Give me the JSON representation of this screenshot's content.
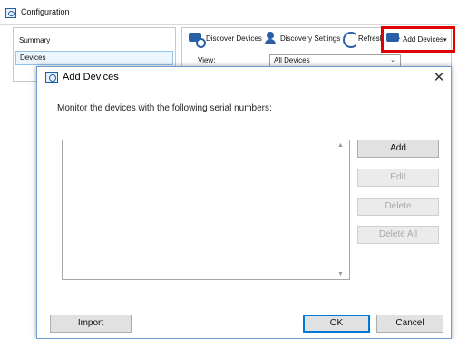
{
  "background_window": {
    "title": "Configuration",
    "nav": {
      "summary": "Summary",
      "devices": "Devices"
    },
    "toolbar": {
      "discover_devices": "Discover Devices",
      "discovery_settings": "Discovery Settings",
      "refresh": "Refresh",
      "add_devices": "Add Devices",
      "add_devices_caret": "▾"
    },
    "view": {
      "label": "View:",
      "selected": "All Devices"
    }
  },
  "dialog": {
    "title": "Add Devices",
    "close_glyph": "✕",
    "instructions": "Monitor the devices with the following serial numbers:",
    "list": {
      "items": [],
      "scroll_up_glyph": "▲",
      "scroll_down_glyph": "▼"
    },
    "buttons": {
      "add": "Add",
      "edit": "Edit",
      "delete": "Delete",
      "delete_all": "Delete All",
      "import": "Import",
      "ok": "OK",
      "cancel": "Cancel"
    }
  },
  "colors": {
    "highlight": "#e00000",
    "accent": "#0078d7",
    "icon_blue": "#2a5fa6"
  },
  "icons": {
    "app": "app-gauge-icon",
    "discover": "monitor-search-icon",
    "discovery_settings": "person-gear-icon",
    "refresh": "refresh-icon",
    "add_devices": "monitor-plus-icon",
    "close": "close-icon"
  }
}
